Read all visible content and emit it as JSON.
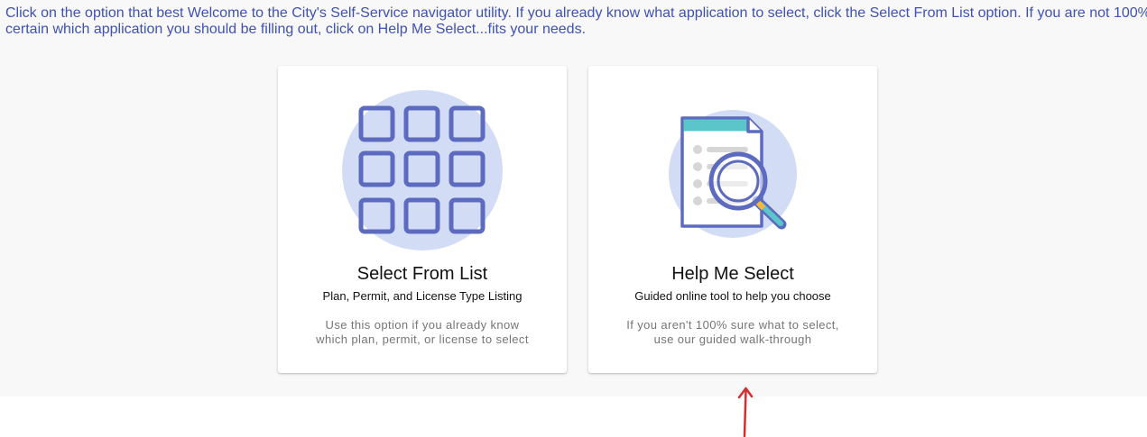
{
  "intro": {
    "line1": "Click on the option that best Welcome to the City's Self-Service navigator utility. If you already know what application to select, click the Select From List option. If you are not 100%",
    "line2": "certain which application you should be filling out, click on Help Me Select...fits your needs."
  },
  "cards": [
    {
      "title": "Select From List",
      "subtitle": "Plan, Permit, and License Type Listing",
      "description_line1": "Use this option if you already know",
      "description_line2": "which plan, permit, or license to select",
      "icon": "grid-icon"
    },
    {
      "title": "Help Me Select",
      "subtitle": "Guided online tool to help you choose",
      "description_line1": "If you aren't 100% sure what to select,",
      "description_line2": "use our guided walk-through",
      "icon": "document-search-icon"
    }
  ],
  "colors": {
    "accent": "#3f51b5",
    "icon_stroke": "#5c6bc0",
    "icon_circle": "#d3dcf5",
    "doc_header": "#5bc6c9",
    "annotation_arrow": "#d32f2f"
  }
}
